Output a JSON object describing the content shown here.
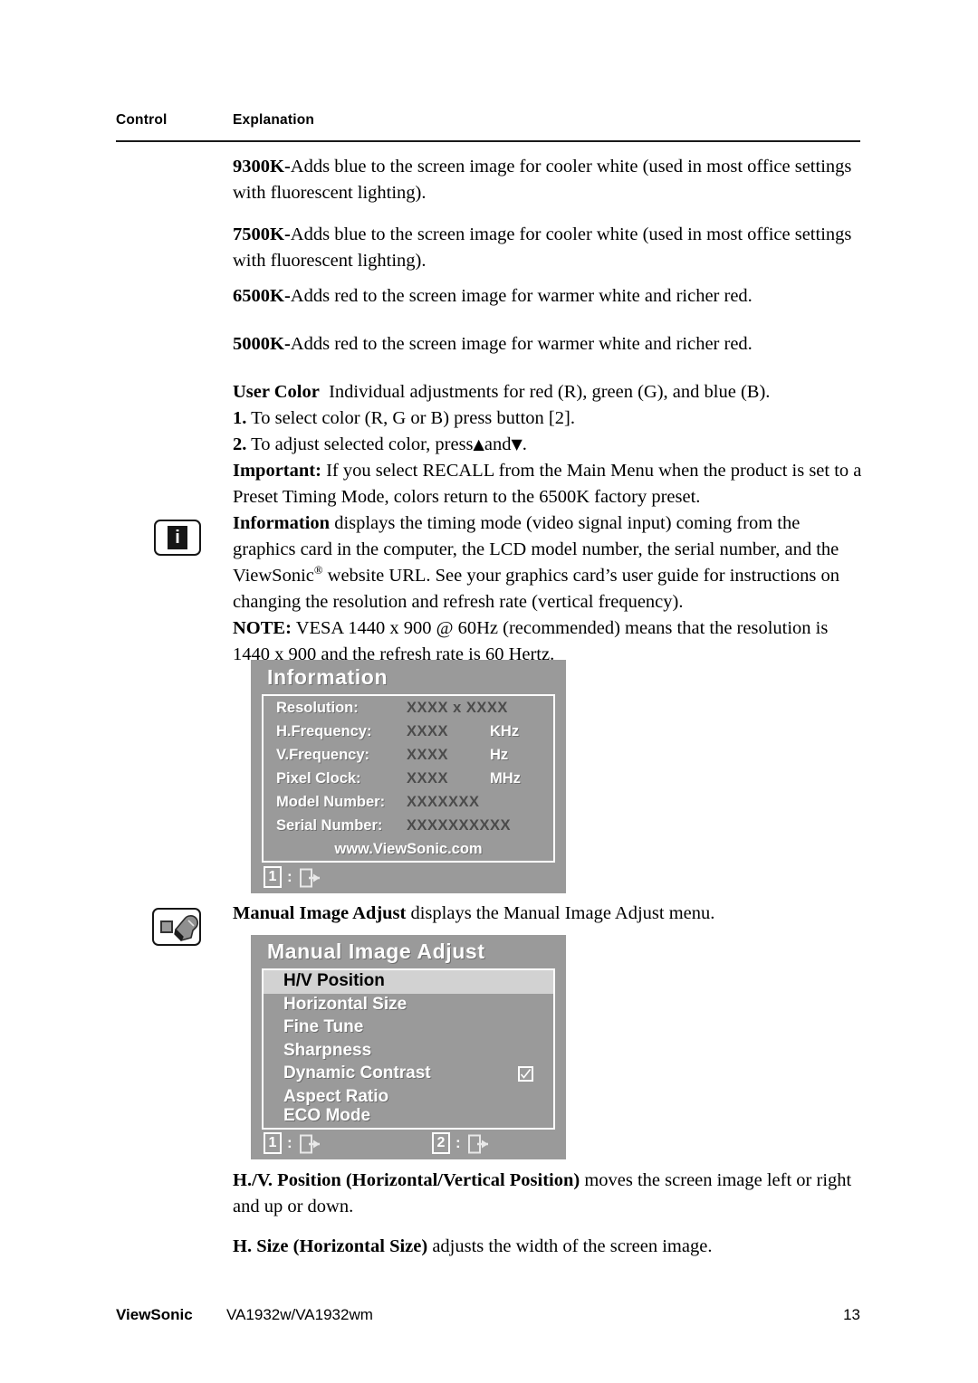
{
  "header": {
    "control_label": "Control",
    "explanation_label": "Explanation"
  },
  "body": {
    "p9300_term": "9300K-",
    "p9300_text": "Adds blue to the screen image for cooler white (used in most office settings with fluorescent lighting).",
    "p7500_term": "7500K-",
    "p7500_text": "Adds blue to the screen image for cooler white (used in most office settings with fluorescent lighting).",
    "p6500_term": "6500K-",
    "p6500_text": "Adds red to the screen image for warmer white and richer red.",
    "p5000_term": "5000K-",
    "p5000_text": "Adds red to the screen image for warmer white and richer red.",
    "usercolor_term": "User Color",
    "usercolor_text": "Individual adjustments for red (R), green (G),  and blue (B).",
    "usercolor_step1_num": "1.",
    "usercolor_step1_text": "To select color (R, G or B) press button [2].",
    "usercolor_step2_num": "2.",
    "usercolor_step2_text_a": "To adjust selected color, press",
    "usercolor_step2_up": "▲",
    "usercolor_step2_and": "and",
    "usercolor_step2_down": "▼",
    "usercolor_step2_text_b": ".",
    "usercolor_important_term": "Important:",
    "usercolor_important_text": "If you select RECALL from the Main Menu when the product is set to a Preset Timing Mode, colors return to the 6500K factory preset.",
    "information_term": "Information",
    "information_text_a": "displays the timing mode (video signal input) coming from the graphics card in the computer, the LCD model number, the serial number, and the ViewSonic",
    "information_reg": "®",
    "information_text_b": "website URL. See your graphics card’s user guide for instructions on changing the resolution and refresh rate (vertical frequency).",
    "information_note_term": "NOTE:",
    "information_note_text": "VESA 1440 x 900 @ 60Hz (recommended) means that the resolution is 1440 x 900 and the refresh rate is 60 Hertz.",
    "manual_term": "Manual Image Adjust",
    "manual_text": "displays the Manual Image Adjust menu.",
    "hvpos_term": "H./V. Position (Horizontal/Vertical Position)",
    "hvpos_text": "moves the screen image left or right and up or down.",
    "hsize_term": "H. Size (Horizontal Size)",
    "hsize_text": "adjusts the width of the screen image."
  },
  "icons": {
    "information_icon_letter": "i"
  },
  "osd_information": {
    "title": "Information",
    "rows": [
      {
        "label": "Resolution:",
        "value": "XXXX x XXXX",
        "unit": ""
      },
      {
        "label": "H.Frequency:",
        "value": "XXXX",
        "unit": "KHz"
      },
      {
        "label": "V.Frequency:",
        "value": "XXXX",
        "unit": "Hz"
      },
      {
        "label": "Pixel Clock:",
        "value": "XXXX",
        "unit": "MHz"
      },
      {
        "label": "Model Number:",
        "value": "XXXXXXX",
        "unit": ""
      },
      {
        "label": "Serial Number:",
        "value": "XXXXXXXXXX",
        "unit": ""
      }
    ],
    "url": "www.ViewSonic.com",
    "footer": {
      "key1": "1",
      "separator": ":"
    },
    "background_color": "#9a9a9a",
    "label_color": "#ffffff",
    "value_color": "#4b4b4b"
  },
  "osd_manual_image_adjust": {
    "title": "Manual Image Adjust",
    "items": [
      {
        "label": "H/V Position",
        "selected": true,
        "checkbox": false
      },
      {
        "label": "Horizontal Size",
        "selected": false,
        "checkbox": false
      },
      {
        "label": "Fine Tune",
        "selected": false,
        "checkbox": false
      },
      {
        "label": "Sharpness",
        "selected": false,
        "checkbox": false
      },
      {
        "label": "Dynamic Contrast",
        "selected": false,
        "checkbox": true
      },
      {
        "label": "Aspect Ratio",
        "selected": false,
        "checkbox": false
      },
      {
        "label": "ECO Mode",
        "selected": false,
        "checkbox": false
      }
    ],
    "footer": {
      "key1": "1",
      "key2": "2",
      "separator": ":"
    },
    "highlight_color": "#d2d2d2",
    "background_color": "#9a9a9a"
  },
  "footer": {
    "brand": "ViewSonic",
    "model": "VA1932w/VA1932wm",
    "page_number": "13"
  }
}
